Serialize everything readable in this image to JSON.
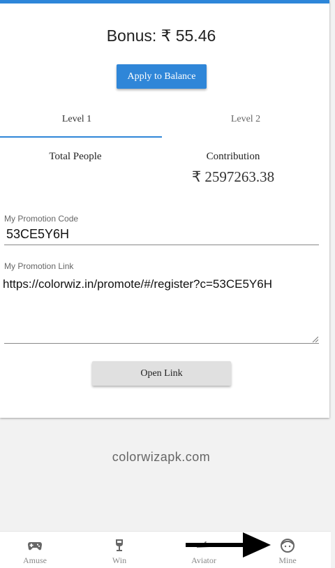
{
  "header": {
    "bonus_text": "Bonus: ₹ 55.46",
    "apply_label": "Apply to Balance"
  },
  "tabs": [
    {
      "label": "Level 1",
      "active": true
    },
    {
      "label": "Level 2",
      "active": false
    }
  ],
  "stats": {
    "total_people_label": "Total People",
    "contribution_label": "Contribution",
    "contribution_value": "₹ 2597263.38"
  },
  "promo": {
    "code_label": "My Promotion Code",
    "code_value": "53CE5Y6H",
    "link_label": "My Promotion Link",
    "link_value": "https://colorwiz.in/promote/#/register?c=53CE5Y6H",
    "open_label": "Open Link"
  },
  "watermark": "colorwizapk.com",
  "bottom_nav": [
    {
      "label": "Amuse",
      "icon": "gamepad-icon"
    },
    {
      "label": "Win",
      "icon": "trophy-icon"
    },
    {
      "label": "Aviator",
      "icon": "plane-icon"
    },
    {
      "label": "Mine",
      "icon": "face-icon"
    }
  ],
  "colors": {
    "accent": "#2f86d8",
    "background": "#f2f2f2",
    "button_secondary": "#e0e0e0"
  }
}
